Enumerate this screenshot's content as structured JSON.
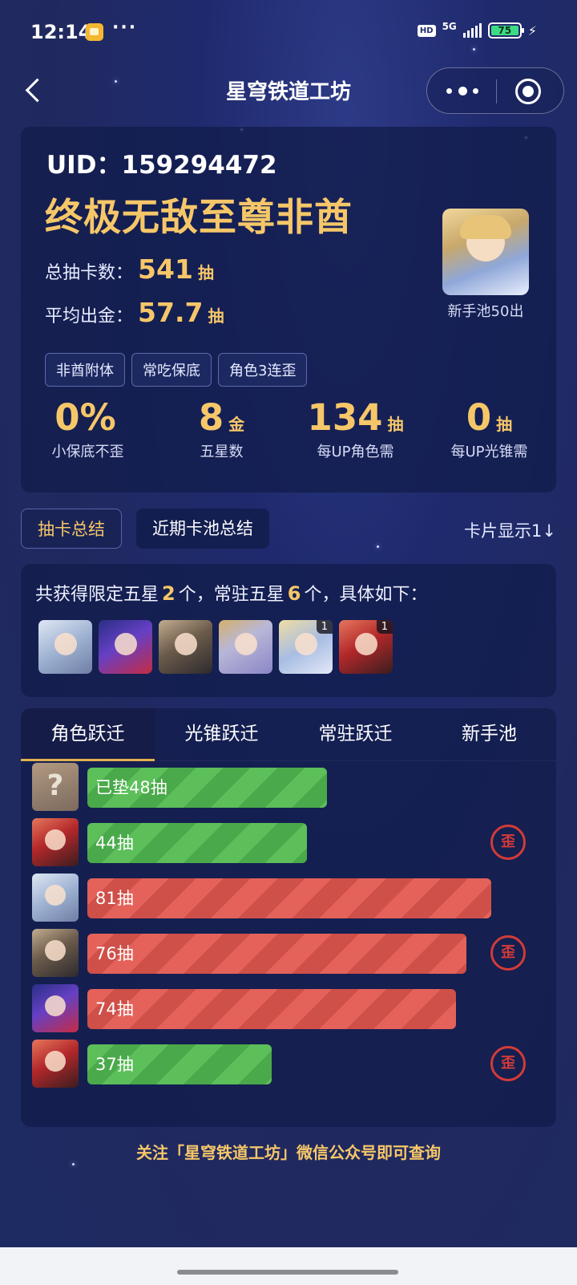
{
  "status": {
    "time": "12:14",
    "hd": "HD",
    "net": "5G",
    "battery": "75"
  },
  "nav": {
    "title": "星穹铁道工坊"
  },
  "profile": {
    "uid": "UID：159294472",
    "rank": "终极无敌至尊非酋",
    "total_label": "总抽卡数：",
    "total_value": "541",
    "total_unit": "抽",
    "avg_label": "平均出金：",
    "avg_value": "57.7",
    "avg_unit": "抽",
    "tags": [
      "非酋附体",
      "常吃保底",
      "角色3连歪"
    ],
    "avatar_caption": "新手池50出"
  },
  "big_stats": [
    {
      "value": "0%",
      "unit": "",
      "label": "小保底不歪"
    },
    {
      "value": "8",
      "unit": "金",
      "label": "五星数"
    },
    {
      "value": "134",
      "unit": "抽",
      "label": "每UP角色需"
    },
    {
      "value": "0",
      "unit": "抽",
      "label": "每UP光锥需"
    }
  ],
  "segments": {
    "summary": "抽卡总结",
    "recent": "近期卡池总结",
    "card_toggle": "卡片显示1↓"
  },
  "summary": {
    "prefix": "共获得限定五星",
    "limited": "2",
    "mid": "个，常驻五星",
    "standard": "6",
    "suffix": "个，具体如下：",
    "thumbs": [
      {
        "cls": "t-jingliu",
        "count": ""
      },
      {
        "cls": "t-seele",
        "count": ""
      },
      {
        "cls": "t-welt",
        "count": ""
      },
      {
        "cls": "t-lc",
        "count": ""
      },
      {
        "cls": "t-gepard",
        "count": "1"
      },
      {
        "cls": "t-himeko",
        "count": "1"
      }
    ]
  },
  "warp_tabs": [
    "角色跃迁",
    "光锥跃迁",
    "常驻跃迁",
    "新手池"
  ],
  "warp_rows": [
    {
      "label": "已垫48抽",
      "pulls": 48,
      "color": "green",
      "lost": false,
      "avatar": "unknown"
    },
    {
      "label": "44抽",
      "pulls": 44,
      "color": "green",
      "lost": true,
      "avatar": "t-himeko"
    },
    {
      "label": "81抽",
      "pulls": 81,
      "color": "red",
      "lost": false,
      "avatar": "t-jingliu"
    },
    {
      "label": "76抽",
      "pulls": 76,
      "color": "red",
      "lost": true,
      "avatar": "t-welt"
    },
    {
      "label": "74抽",
      "pulls": 74,
      "color": "red",
      "lost": false,
      "avatar": "t-seele"
    },
    {
      "label": "37抽",
      "pulls": 37,
      "color": "green",
      "lost": true,
      "avatar": "t-himeko"
    }
  ],
  "lost_badge": "歪",
  "unknown_mark": "?",
  "footer": "关注「星穹铁道工坊」微信公众号即可查询"
}
